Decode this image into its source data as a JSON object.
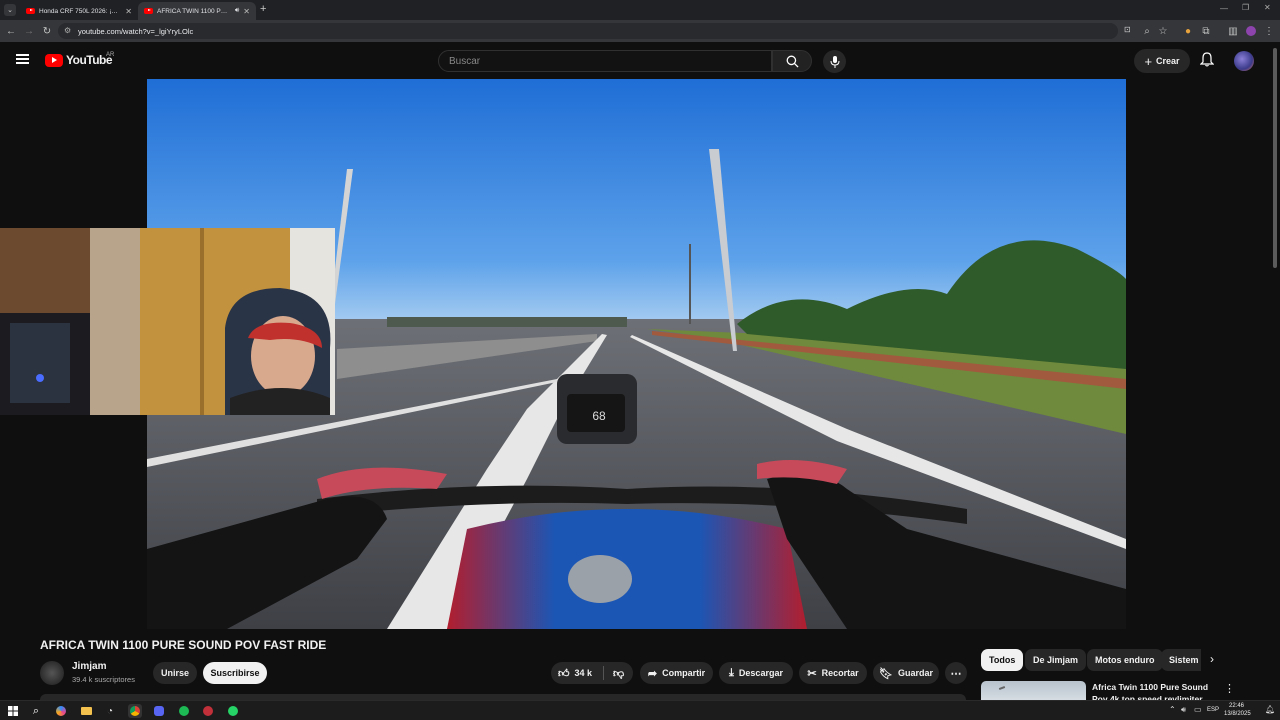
{
  "browser": {
    "tabs": [
      {
        "title": "Honda CRF 750L 2026: ¡La bes",
        "active": false
      },
      {
        "title": "AFRICA TWIN 1100 PURE S",
        "active": true
      }
    ],
    "url": "youtube.com/watch?v=_lgiYryLOlc"
  },
  "youtube": {
    "logo_text": "YouTube",
    "region": "AR",
    "search_placeholder": "Buscar",
    "create_label": "Crear"
  },
  "video": {
    "title": "AFRICA TWIN 1100 PURE SOUND POV FAST RIDE",
    "channel_name": "Jimjam",
    "subscribers": "39.4 k suscriptores",
    "join_label": "Unirse",
    "subscribe_label": "Suscribirse",
    "likes": "34 k",
    "share_label": "Compartir",
    "download_label": "Descargar",
    "clip_label": "Recortar",
    "save_label": "Guardar",
    "dash_speed": "68"
  },
  "sidebar": {
    "chips": [
      "Todos",
      "De Jimjam",
      "Motos enduro",
      "Sistem"
    ],
    "active_chip": "Todos",
    "recommended_title": "Africa Twin 1100 Pure Sound Pov 4k top speed revlimiter"
  },
  "taskbar": {
    "time": "22:46",
    "date": "13/8/2025",
    "lang": "ESP"
  },
  "colors": {
    "accent": "#ff0000",
    "background": "#0f0f0f"
  }
}
